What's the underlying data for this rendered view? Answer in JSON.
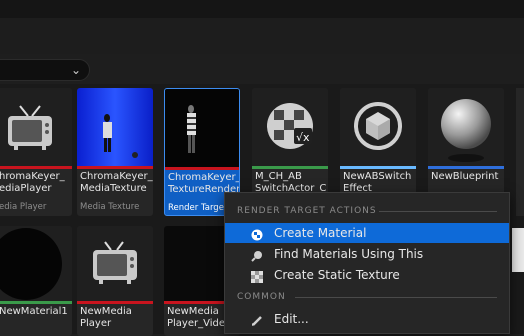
{
  "tiles_row1": [
    {
      "name": "hromaKeyer_\nediaPlayer",
      "type": "edia Player",
      "bar": "#c8141e"
    },
    {
      "name": "ChromaKeyer_\nMediaTexture",
      "type": "Media Texture",
      "bar": "#c8141e"
    },
    {
      "name": "ChromaKeyer_\nTextureRender",
      "type": "Render Target",
      "bar": "#c8141e",
      "selected": true
    },
    {
      "name": "M_CH_AB\nSwitchActor_C",
      "type": "",
      "bar": "#3a9a4a"
    },
    {
      "name": "NewABSwitch\nEffect",
      "type": "",
      "bar": "#69b9ff"
    },
    {
      "name": "NewBlueprint",
      "type": "",
      "bar": "#2f6fdc"
    }
  ],
  "tiles_row2": [
    {
      "name": "NewMaterial1",
      "bar": "#3a9a4a"
    },
    {
      "name": "NewMedia\nPlayer",
      "bar": "#c8141e"
    },
    {
      "name": "NewMedia\nPlayer_Vide",
      "bar": "#c8141e"
    }
  ],
  "context_menu": {
    "section_render": "RENDER TARGET ACTIONS",
    "items": [
      {
        "label": "Create Material",
        "icon": "material-sphere-icon",
        "highlighted": true
      },
      {
        "label": "Find Materials Using This",
        "icon": "magnifier-icon"
      },
      {
        "label": "Create Static Texture",
        "icon": "checker-texture-icon"
      }
    ],
    "section_common": "COMMON",
    "common_items": [
      {
        "label": "Edit...",
        "icon": "pencil-icon"
      }
    ]
  },
  "colors": {
    "accent": "#0e6ad8",
    "selected_tile": "#0f5fc4"
  }
}
